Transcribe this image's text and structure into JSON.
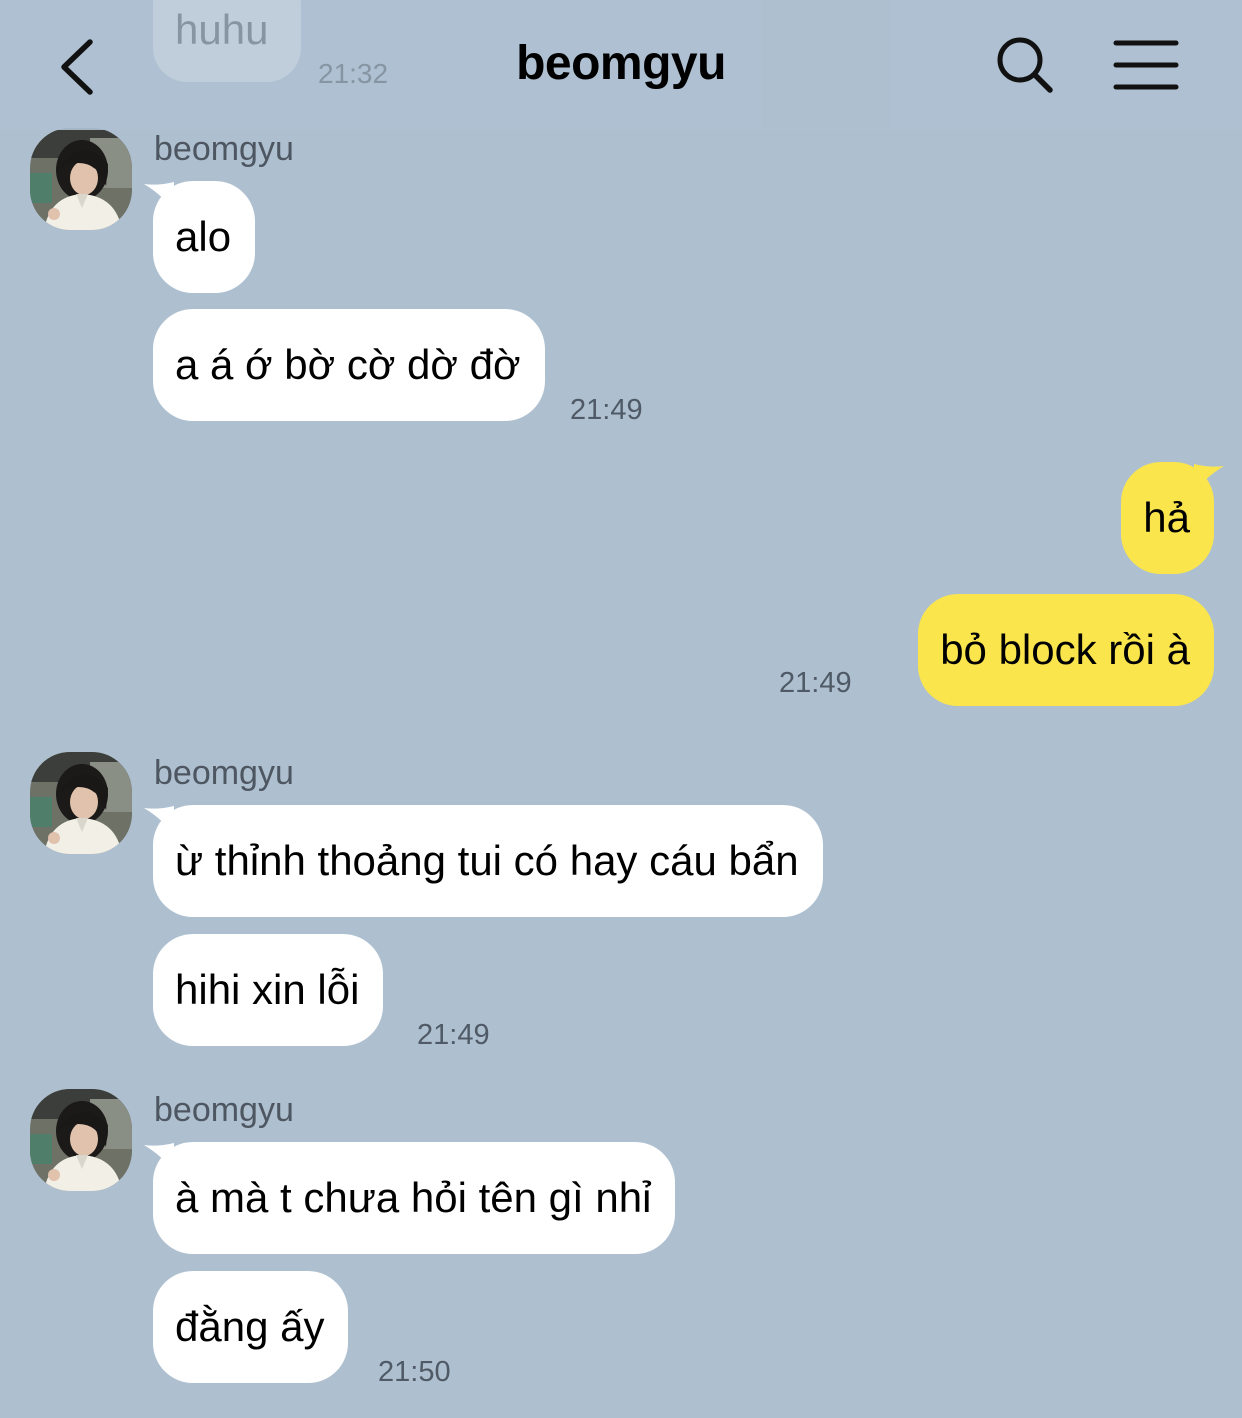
{
  "header": {
    "title": "beomgyu",
    "back_icon": "chevron-left-icon",
    "search_icon": "search-icon",
    "menu_icon": "hamburger-menu-icon"
  },
  "previous_message": {
    "text": "huhu",
    "time": "21:32"
  },
  "colors": {
    "background": "#aec0d0",
    "incoming_bubble": "#ffffff",
    "outgoing_bubble": "#fbe54d",
    "timestamp": "#505a66"
  },
  "groups": [
    {
      "sender": "beomgyu",
      "messages": [
        "alo",
        "a á ớ bờ cờ dờ đờ"
      ],
      "time": "21:49"
    },
    {
      "sender": "me",
      "messages": [
        "hả",
        "bỏ block rồi à"
      ],
      "time": "21:49"
    },
    {
      "sender": "beomgyu",
      "messages": [
        "ừ thỉnh thoảng tui có hay cáu bẩn",
        "hihi xin lỗi"
      ],
      "time": "21:49"
    },
    {
      "sender": "beomgyu",
      "messages": [
        "à mà t chưa hỏi tên gì nhỉ",
        "đằng ấy"
      ],
      "time": "21:50"
    }
  ]
}
